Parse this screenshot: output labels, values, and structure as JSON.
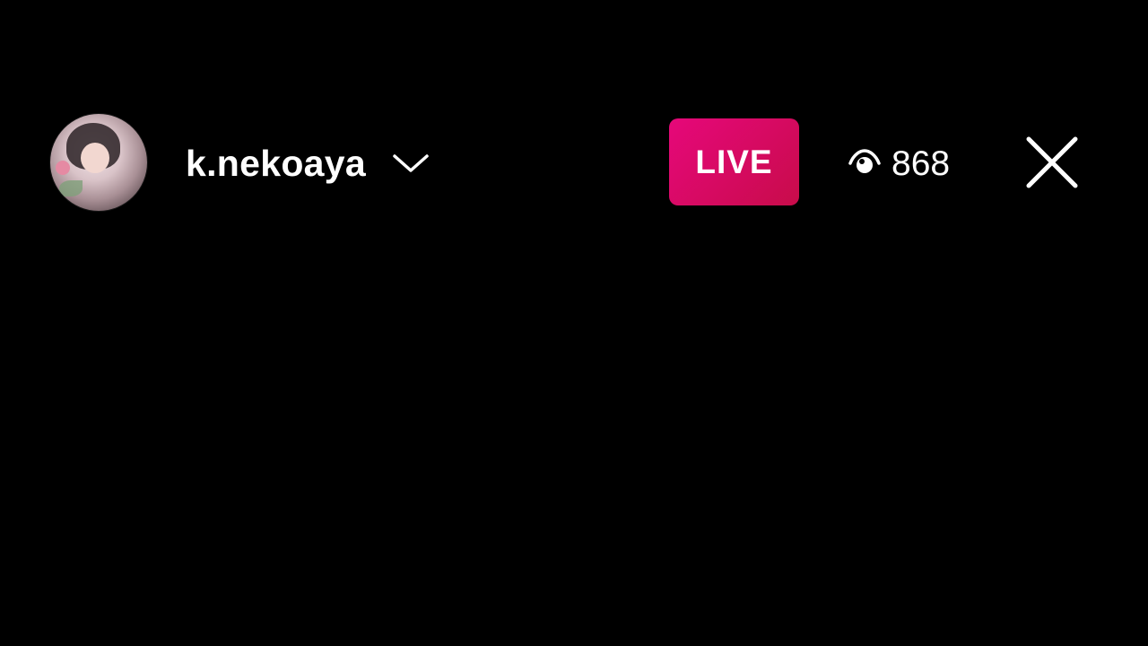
{
  "header": {
    "username": "k.nekoaya",
    "live_label": "LIVE",
    "viewer_count": "868"
  },
  "icons": {
    "avatar": "profile-avatar",
    "username_dropdown": "chevron-down-icon",
    "viewers": "eye-icon",
    "close": "close-icon"
  },
  "colors": {
    "background": "#000000",
    "live_badge": "#e6087a",
    "text": "#ffffff"
  }
}
